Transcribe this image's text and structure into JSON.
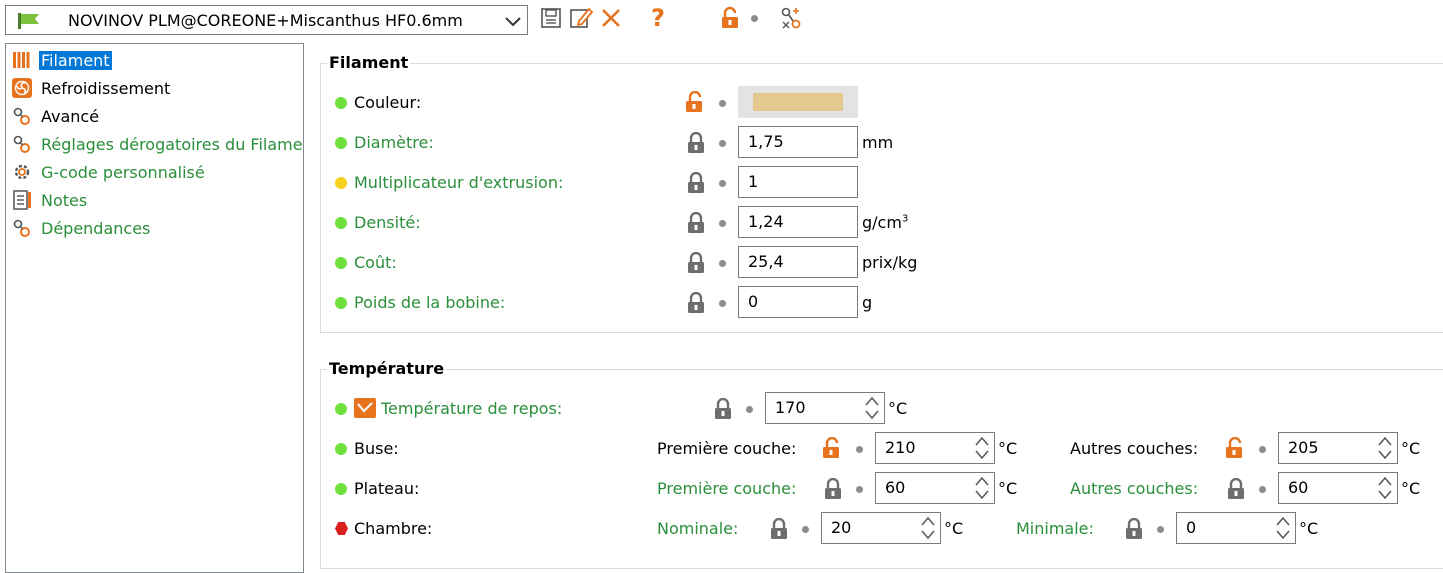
{
  "toolbar": {
    "preset_name": "NOVINOV PLM@COREONE+Miscanthus HF0.6mm",
    "help_glyph": "?",
    "icons": [
      "flag-icon",
      "chevron-down-icon",
      "save-icon",
      "rename-icon",
      "delete-icon",
      "help-icon",
      "unlocked-icon",
      "compare-icon"
    ]
  },
  "tree": {
    "items": [
      {
        "label": "Filament",
        "icon": "filament-icon",
        "selected": true
      },
      {
        "label": "Refroidissement",
        "icon": "fan-icon"
      },
      {
        "label": "Avancé",
        "icon": "advanced-icon"
      },
      {
        "label": "Réglages dérogatoires du Filament",
        "icon": "overrides-icon"
      },
      {
        "label": "G-code personnalisé",
        "icon": "gcode-icon"
      },
      {
        "label": "Notes",
        "icon": "notes-icon"
      },
      {
        "label": "Dépendances",
        "icon": "dependencies-icon"
      }
    ]
  },
  "filament_group": {
    "title": "Filament",
    "rows": [
      {
        "label": "Couleur:",
        "value": "",
        "unit": "",
        "color": "#e5c88d"
      },
      {
        "label": "Diamètre:",
        "value": "1,75",
        "unit": "mm"
      },
      {
        "label": "Multiplicateur d'extrusion:",
        "value": "1",
        "unit": ""
      },
      {
        "label": "Densité:",
        "value": "1,24",
        "unit": "g/cm",
        "unit_sup": "3"
      },
      {
        "label": "Coût:",
        "value": "25,4",
        "unit": "prix/kg"
      },
      {
        "label": "Poids de la bobine:",
        "value": "0",
        "unit": "g"
      }
    ]
  },
  "temperature_group": {
    "title": "Température",
    "repos": {
      "label": "Température de repos:",
      "value": "170",
      "unit": "°C"
    },
    "buse": {
      "label": "Buse:",
      "first_label": "Première couche:",
      "first_value": "210",
      "first_unit": "°C",
      "other_label": "Autres couches:",
      "other_value": "205",
      "other_unit": "°C"
    },
    "plateau": {
      "label": "Plateau:",
      "first_label": "Première couche:",
      "first_value": "60",
      "first_unit": "°C",
      "other_label": "Autres couches:",
      "other_value": "60",
      "other_unit": "°C"
    },
    "chambre": {
      "label": "Chambre:",
      "nominal_label": "Nominale:",
      "nominal_value": "20",
      "nominal_unit": "°C",
      "min_label": "Minimale:",
      "min_value": "0",
      "min_unit": "°C"
    }
  },
  "colors": {
    "accent_orange": "#e8731e",
    "selection_blue": "#0078d7",
    "label_green": "#2a8f3a",
    "status_green": "#6fe03c",
    "status_yellow": "#f5d21b",
    "status_red": "#d9201c"
  }
}
